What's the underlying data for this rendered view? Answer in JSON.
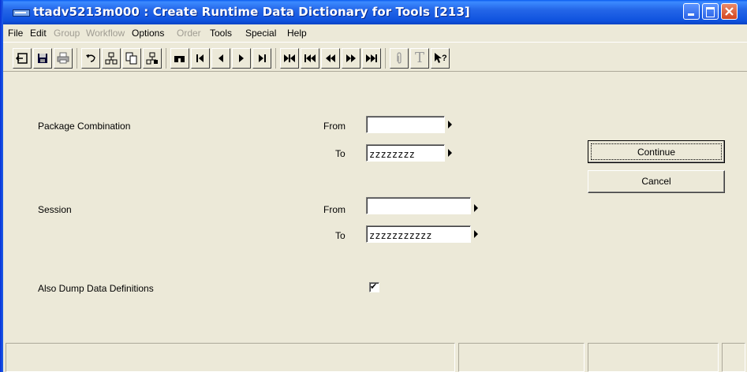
{
  "window": {
    "title": "ttadv5213m000 : Create Runtime Data Dictionary for Tools [213]"
  },
  "menubar": {
    "items": [
      {
        "label": "File",
        "enabled": true
      },
      {
        "label": "Edit",
        "enabled": true
      },
      {
        "label": "Group",
        "enabled": false
      },
      {
        "label": "Workflow",
        "enabled": false
      },
      {
        "label": "Options",
        "enabled": true
      },
      {
        "label": "Order",
        "enabled": false
      },
      {
        "label": "Tools",
        "enabled": true
      },
      {
        "label": "Special",
        "enabled": true
      },
      {
        "label": "Help",
        "enabled": true
      }
    ]
  },
  "toolbar": {
    "buttons": [
      "exit-icon",
      "save-icon",
      "print-icon",
      "undo-icon",
      "insert-record-icon",
      "copy-icon",
      "delete-record-icon",
      "find-icon",
      "first-record-icon",
      "previous-record-icon",
      "next-record-icon",
      "last-record-icon",
      "first-page-icon",
      "previous-page-icon",
      "page-back-icon",
      "page-forward-icon",
      "last-page-icon",
      "attachment-icon",
      "text-icon",
      "help-pointer-icon"
    ],
    "text_glyph": "T"
  },
  "form": {
    "package_combination": {
      "label": "Package Combination",
      "from_label": "From",
      "from_value": "",
      "to_label": "To",
      "to_value": "zzzzzzzz"
    },
    "session": {
      "label": "Session",
      "from_label": "From",
      "from_value": "",
      "to_label": "To",
      "to_value": "zzzzzzzzzzz"
    },
    "dump_data_definitions": {
      "label": "Also Dump Data Definitions",
      "checked": true,
      "check_glyph": "✔"
    },
    "continue_label": "Continue",
    "cancel_label": "Cancel"
  },
  "statusbar": {
    "panels": [
      "",
      "",
      "",
      ""
    ]
  }
}
